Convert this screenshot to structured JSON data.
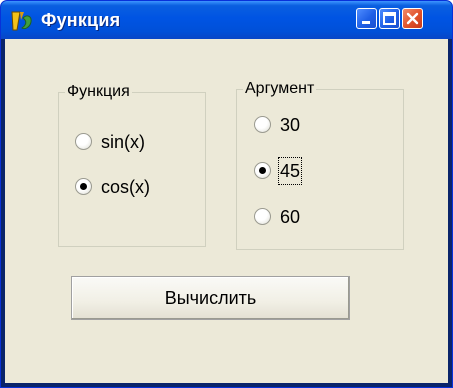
{
  "window": {
    "title": "Функция",
    "controls": {
      "minimize": "minimize-icon",
      "maximize": "maximize-icon",
      "close": "close-icon"
    }
  },
  "function_group": {
    "title": "Функция",
    "options": [
      {
        "label": "sin(x)",
        "selected": false
      },
      {
        "label": "cos(x)",
        "selected": true
      }
    ]
  },
  "argument_group": {
    "title": "Аргумент",
    "options": [
      {
        "label": "30",
        "selected": false
      },
      {
        "label": "45",
        "selected": true
      },
      {
        "label": "60",
        "selected": false
      }
    ]
  },
  "compute_button": {
    "label": "Вычислить"
  },
  "colors": {
    "titlebar": "#0054e3",
    "client": "#ece9d8",
    "close": "#e0512a"
  }
}
